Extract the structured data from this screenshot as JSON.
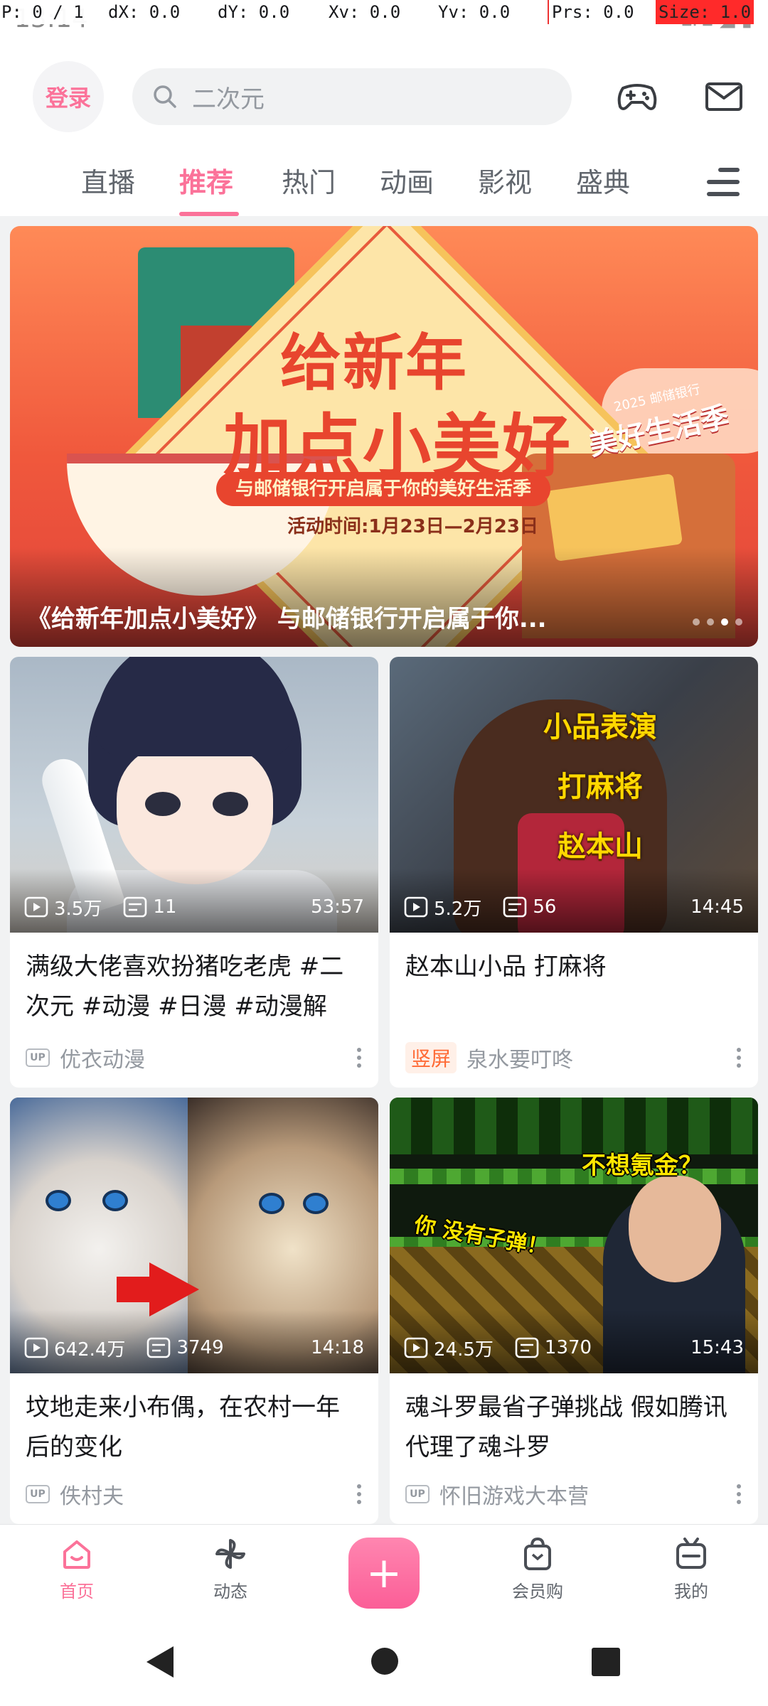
{
  "debug": {
    "p": "P: 0 / 1",
    "dx": "dX: 0.0",
    "dy": "dY: 0.0",
    "xv": "Xv: 0.0",
    "yv": "Yv: 0.0",
    "prs": "Prs: 0.0",
    "size": "Size: 1.0"
  },
  "status": {
    "time": "13:14",
    "icons": "LTE ◢ ▮"
  },
  "header": {
    "login_label": "登录",
    "search_placeholder": "二次元",
    "icons": [
      "gamepad-icon",
      "mail-icon"
    ]
  },
  "tabs": [
    {
      "label": "直播"
    },
    {
      "label": "推荐",
      "active": true
    },
    {
      "label": "热门"
    },
    {
      "label": "动画"
    },
    {
      "label": "影视"
    },
    {
      "label": "盛典"
    }
  ],
  "banner": {
    "headline1": "给新年",
    "headline2": "加点小美好",
    "pill": "与邮储银行开启属于你的美好生活季",
    "date": "活动时间:1月23日—2月23日",
    "badge_year": "2025 邮储银行",
    "badge": "美好生活季",
    "caption": "《给新年加点小美好》 与邮储银行开启属于你...",
    "dot_count": 4,
    "active_dot": 2
  },
  "cards": [
    {
      "views": "3.5万",
      "danmaku": "11",
      "duration": "53:57",
      "title": "满级大佬喜欢扮猪吃老虎 #二次元 #动漫 #日漫 #动漫解说...",
      "badge": "UP",
      "author": "优衣动漫"
    },
    {
      "views": "5.2万",
      "danmaku": "56",
      "duration": "14:45",
      "thumb_text": [
        "小品表演",
        "打麻将",
        "赵本山"
      ],
      "title": "赵本山小品 打麻将",
      "badge": "竖屏",
      "author": "泉水要叮咚"
    },
    {
      "views": "642.4万",
      "danmaku": "3749",
      "duration": "14:18",
      "title": "坟地走来小布偶，在农村一年后的变化",
      "badge": "UP",
      "author": "佚村夫"
    },
    {
      "views": "24.5万",
      "danmaku": "1370",
      "duration": "15:43",
      "thumb_text": [
        "不想氪金？",
        "你 没有子弹！"
      ],
      "title": "魂斗罗最省子弹挑战 假如腾讯代理了魂斗罗",
      "badge": "UP",
      "author": "怀旧游戏大本营"
    }
  ],
  "bottom_nav": [
    {
      "label": "首页",
      "icon": "home-icon",
      "active": true
    },
    {
      "label": "动态",
      "icon": "pinwheel-icon"
    },
    {
      "label": "+",
      "icon": "plus-icon"
    },
    {
      "label": "会员购",
      "icon": "shopping-bag-icon"
    },
    {
      "label": "我的",
      "icon": "tv-icon"
    }
  ],
  "colors": {
    "accent": "#fb7299",
    "text": "#18191c",
    "muted": "#9499a0"
  }
}
